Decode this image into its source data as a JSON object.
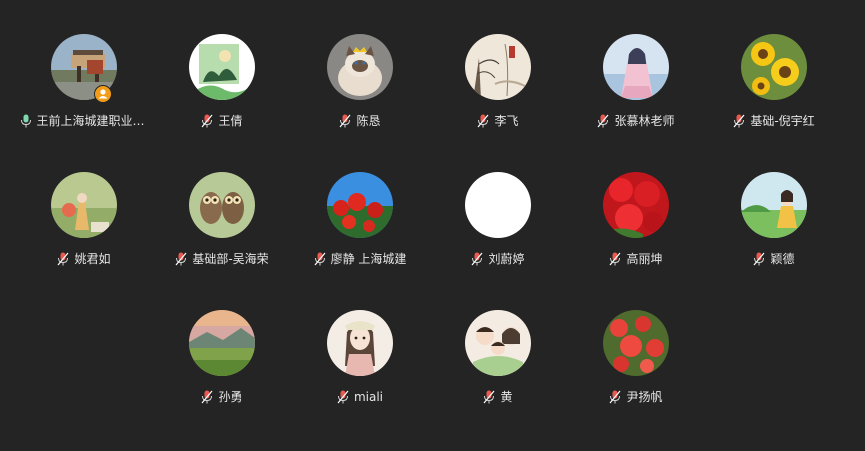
{
  "participants": [
    {
      "name": "王前上海城建职业学院",
      "avatar": "bridge-photo-avatar",
      "mic": "speaking-mic-icon",
      "host": true
    },
    {
      "name": "王倩",
      "avatar": "green-cartoon-avatar",
      "mic": "muted-mic-icon",
      "host": false
    },
    {
      "name": "陈恳",
      "avatar": "cat-photo-avatar",
      "mic": "muted-mic-icon",
      "host": false
    },
    {
      "name": "李飞",
      "avatar": "ink-painting-avatar",
      "mic": "muted-mic-icon",
      "host": false
    },
    {
      "name": "张慕林老师",
      "avatar": "anime-girl-avatar",
      "mic": "muted-mic-icon",
      "host": false
    },
    {
      "name": "基础-倪宇红",
      "avatar": "sunflower-avatar",
      "mic": "muted-mic-icon",
      "host": false
    },
    {
      "name": "姚君如",
      "avatar": "april-illustration-avatar",
      "mic": "muted-mic-icon",
      "host": false
    },
    {
      "name": "基础部-吴海荣",
      "avatar": "owls-avatar",
      "mic": "muted-mic-icon",
      "host": false
    },
    {
      "name": "廖静 上海城建",
      "avatar": "red-flowers-sky-avatar",
      "mic": "muted-mic-icon",
      "host": false
    },
    {
      "name": "刘蔚婷",
      "avatar": "blank-white-avatar",
      "mic": "muted-mic-icon",
      "host": false
    },
    {
      "name": "高丽坤",
      "avatar": "red-flowers-avatar",
      "mic": "muted-mic-icon",
      "host": false
    },
    {
      "name": "颖德",
      "avatar": "girl-garden-avatar",
      "mic": "muted-mic-icon",
      "host": false
    },
    {
      "name": "孙勇",
      "avatar": "landscape-avatar",
      "mic": "muted-mic-icon",
      "host": false
    },
    {
      "name": "miali",
      "avatar": "cartoon-girl-avatar",
      "mic": "muted-mic-icon",
      "host": false
    },
    {
      "name": "黄",
      "avatar": "cartoon-family-avatar",
      "mic": "muted-mic-icon",
      "host": false
    },
    {
      "name": "尹扬帆",
      "avatar": "quince-flowers-avatar",
      "mic": "muted-mic-icon",
      "host": false
    }
  ],
  "colors": {
    "background": "#242424",
    "text": "#e6e6e6",
    "muted_mic": "#e85a4f",
    "speaking_mic": "#7fd7b0",
    "host_badge": "#f29d1a"
  }
}
